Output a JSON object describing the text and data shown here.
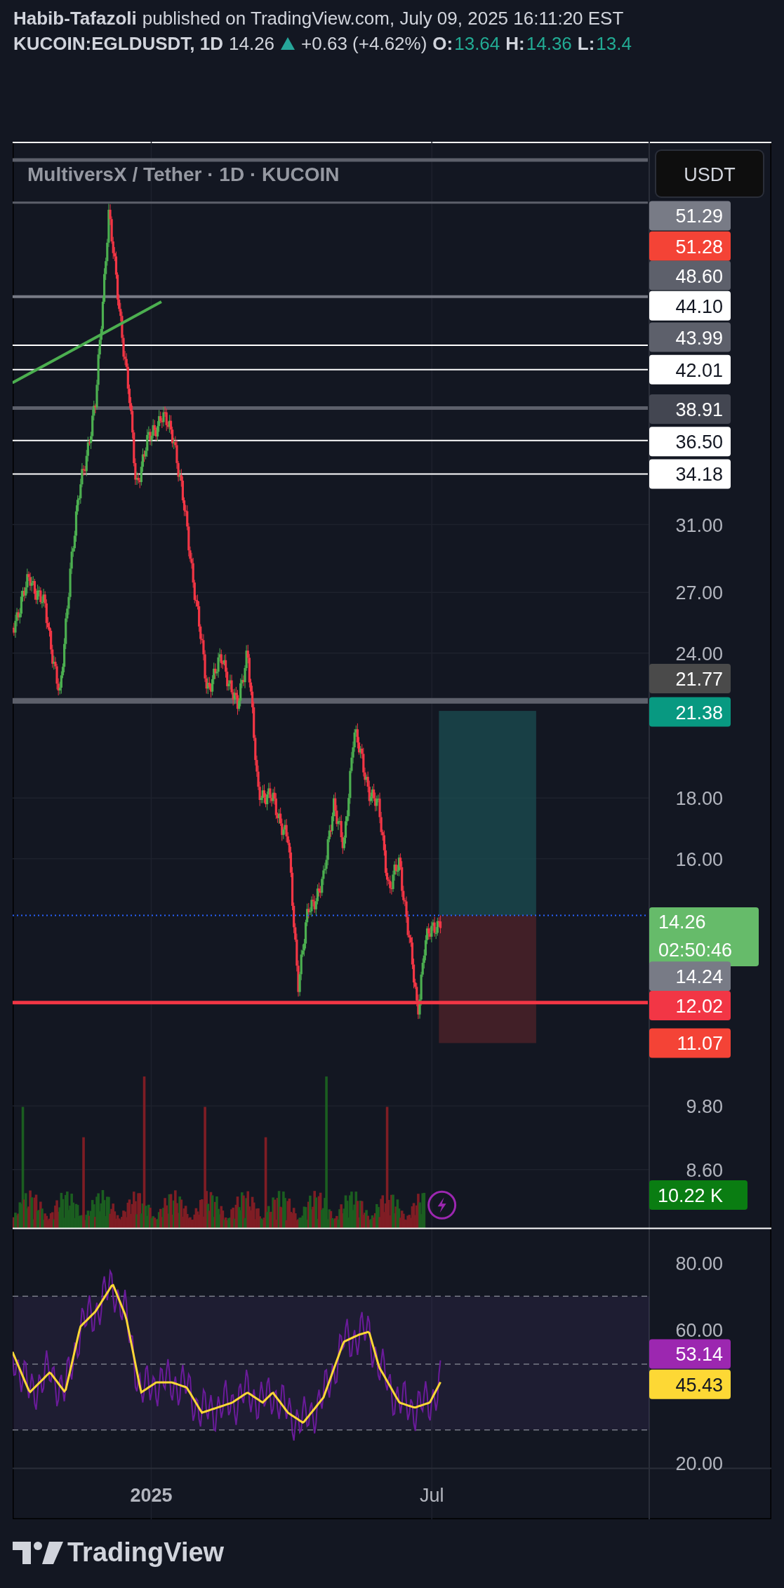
{
  "header": {
    "author": "Habib-Tafazoli",
    "published": "published on TradingView.com, July 09, 2025 16:11:20 EST",
    "symbol": "KUCOIN:EGLDUSDT, 1D",
    "last": "14.26",
    "change": "+0.63 (+4.62%)",
    "ohlc": [
      {
        "label": "O:",
        "value": "13.64"
      },
      {
        "label": "H:",
        "value": "14.36"
      },
      {
        "label": "L:",
        "value": "13.4"
      }
    ]
  },
  "legend": {
    "title": "MultiversX / Tether · 1D · KUCOIN"
  },
  "currency_button": "USDT",
  "price_axis": {
    "ticks": [
      "31.00",
      "27.00",
      "24.00",
      "18.00",
      "16.00",
      "9.80",
      "8.60"
    ],
    "labels": [
      {
        "text": "51.29",
        "color": "#787b86"
      },
      {
        "text": "51.28",
        "color": "#f44336"
      },
      {
        "text": "48.60",
        "color": "#5d606b"
      },
      {
        "text": "44.10",
        "color": "#ffffff"
      },
      {
        "text": "43.99",
        "color": "#5d606b"
      },
      {
        "text": "42.01",
        "color": "#ffffff"
      },
      {
        "text": "38.91",
        "color": "#434651"
      },
      {
        "text": "36.50",
        "color": "#ffffff"
      },
      {
        "text": "34.18",
        "color": "#ffffff"
      },
      {
        "text": "21.77",
        "color": "#4a4a4a"
      },
      {
        "text": "21.38",
        "color": "#089981"
      },
      {
        "text": "14.26",
        "sub": "02:50:46",
        "color": "#66bb6a"
      },
      {
        "text": "14.24",
        "color": "#787b86"
      },
      {
        "text": "12.02",
        "color": "#f23645"
      },
      {
        "text": "11.07",
        "color": "#f44336"
      },
      {
        "text": "10.22 K",
        "color": "#0a7d12"
      }
    ]
  },
  "rsi_axis": {
    "ticks": [
      "80.00",
      "60.00",
      "20.00"
    ],
    "labels": [
      {
        "text": "53.14",
        "color": "#9c27b0"
      },
      {
        "text": "45.43",
        "color": "#fdd835"
      }
    ]
  },
  "time_axis": [
    {
      "text": "2025",
      "bold": true
    },
    {
      "text": "Jul",
      "bold": false
    }
  ],
  "footer": {
    "logo": "TradingView"
  }
}
